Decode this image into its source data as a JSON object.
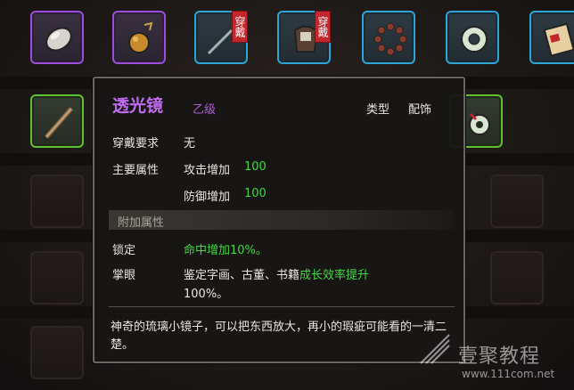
{
  "item": {
    "name": "透光镜",
    "grade": "乙级",
    "type_label": "类型",
    "type_value": "配饰",
    "wear_req_label": "穿戴要求",
    "wear_req_value": "无",
    "main_attr_label": "主要属性",
    "attr1_name": "攻击增加",
    "attr1_value": "100",
    "attr2_name": "防御增加",
    "attr2_value": "100",
    "extra_section_label": "附加属性",
    "lock_label": "锁定",
    "lock_effect": "命中增加10%。",
    "eye_label": "掌眼",
    "eye_effect_prefix": "鉴定字画、古董、书籍",
    "eye_effect_highlight": "成长效率提升",
    "eye_effect_suffix": "100%。",
    "description": "神奇的琉璃小镜子，可以把东西放大，再小的瑕疵可能看的一清二楚。"
  },
  "slots": {
    "equip_tag": "穿戴",
    "row1": [
      "purple",
      "purple",
      "blue",
      "blue",
      "blue",
      "blue",
      "blue"
    ],
    "row2_first": "green",
    "row2_last": "green"
  },
  "colors": {
    "rare_purple": "#9b4ed6",
    "blue": "#2ea3d6",
    "green": "#5fbf2e",
    "stat_green": "#45d646",
    "tag_red": "#c1272d"
  },
  "watermark": {
    "brand": "壹聚教程",
    "url": "www.111com.net"
  }
}
